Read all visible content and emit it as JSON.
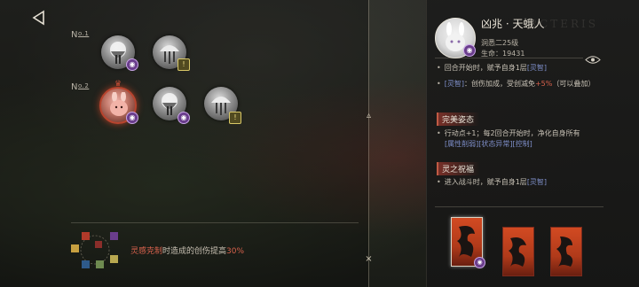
{
  "rows": [
    {
      "label_prefix": "N",
      "label_num": "o.1",
      "enemies": [
        "ghost",
        "jelly"
      ]
    },
    {
      "label_prefix": "N",
      "label_num": "o.2",
      "enemies": [
        "rabbit-selected",
        "ghost",
        "jelly"
      ]
    }
  ],
  "buff": {
    "prefix": "灵感克制",
    "middle": "时造成的创伤提高",
    "value": "30%"
  },
  "enemy_panel": {
    "name": "凶兆 · 天蛾人",
    "level": "洞悉二25级",
    "hp": "生命：19431",
    "watermark": "RCTERIS",
    "effects": [
      {
        "text_a": "回合开始时，赋予自身1层",
        "link": "[灵智]",
        "text_b": ""
      },
      {
        "link": "[灵智]",
        "text_a": "：创伤加成，受创减免",
        "red": "+5%",
        "text_b": "（可以叠加）"
      }
    ],
    "section1_title": "完美姿态",
    "section1_line1": "行动点+1；每2回合开始时，净化自身所有",
    "section1_links": "[属性削弱][状态异常][控制]",
    "section2_title": "灵之祝福",
    "section2_text": "进入战斗时，赋予自身1层",
    "section2_link": "[灵智]"
  },
  "colors": {
    "accent_red": "#d6614c",
    "link_blue": "#7e8fc9",
    "section_red": "#96372d"
  },
  "icons": [
    "back-arrow-icon",
    "eye-icon",
    "warning-icon",
    "spirit-icon",
    "affinity-wheel-icon"
  ]
}
